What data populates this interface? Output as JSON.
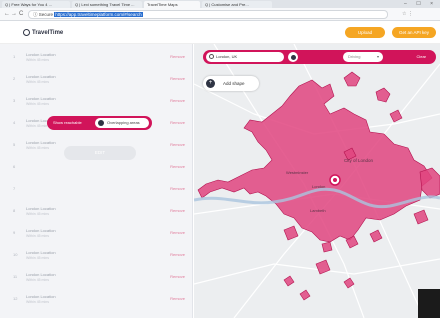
{
  "browser": {
    "tabs": [
      {
        "label": "Q | Free Ways for You 4 ...",
        "active": false
      },
      {
        "label": "Q | Lexi something Travel Time ...",
        "active": false
      },
      {
        "label": "TravelTime Maps",
        "active": true
      },
      {
        "label": "Q | Customise and Pre...",
        "active": false
      }
    ],
    "window_controls": "– ☐ ×",
    "nav": {
      "back": "←",
      "forward": "→",
      "reload": "C"
    },
    "url_prefix": "ⓘ Secure",
    "url": "https://app.traveltimeplatform.com/#/search",
    "extensions": "☆ ⋮"
  },
  "header": {
    "logo_text": "TravelTime",
    "btn_primary": "Upload",
    "btn_secondary": "Get an API key"
  },
  "sidebar": {
    "rows": [
      {
        "num": "1",
        "name": "London Location",
        "sub": "Within 45 mins",
        "action": "Remove"
      },
      {
        "num": "2",
        "name": "London Location",
        "sub": "Within 45 mins",
        "action": "Remove"
      },
      {
        "num": "3",
        "name": "London Location",
        "sub": "Within 45 mins",
        "action": "Remove"
      },
      {
        "num": "4",
        "name": "London Location",
        "sub": "Within 45 mins",
        "action": "Remove"
      },
      {
        "num": "5",
        "name": "London Location",
        "sub": "Within 45 mins",
        "action": "Remove"
      },
      {
        "num": "6",
        "name": "London Location",
        "sub": "Within 45 mins",
        "action": "Remove"
      },
      {
        "num": "7",
        "name": "London Location",
        "sub": "Within 45 mins",
        "action": "Remove"
      },
      {
        "num": "8",
        "name": "London Location",
        "sub": "Within 45 mins",
        "action": "Remove"
      },
      {
        "num": "9",
        "name": "London Location",
        "sub": "Within 45 mins",
        "action": "Remove"
      },
      {
        "num": "10",
        "name": "London Location",
        "sub": "Within 45 mins",
        "action": "Remove"
      },
      {
        "num": "11",
        "name": "London Location",
        "sub": "Within 45 mins",
        "action": "Remove"
      },
      {
        "num": "12",
        "name": "London Location",
        "sub": "Within 45 mins",
        "action": "Remove"
      }
    ],
    "show_reachable_label": "Show reachable",
    "show_reachable_option": "Overlapping areas",
    "ghost_button": "EDIT"
  },
  "map": {
    "search_value": "London, UK",
    "mode_label": "Driving",
    "go_label": "Clear",
    "add_shape_label": "Add shape",
    "labels": {
      "city": "City of London",
      "west": "Westminster",
      "center": "London",
      "south": "Lambeth"
    }
  },
  "colors": {
    "accent": "#d1145a",
    "isochrone_fill": "#e0447f",
    "header_btn": "#f5a623",
    "sidebar_bg": "#f3f4f7"
  }
}
